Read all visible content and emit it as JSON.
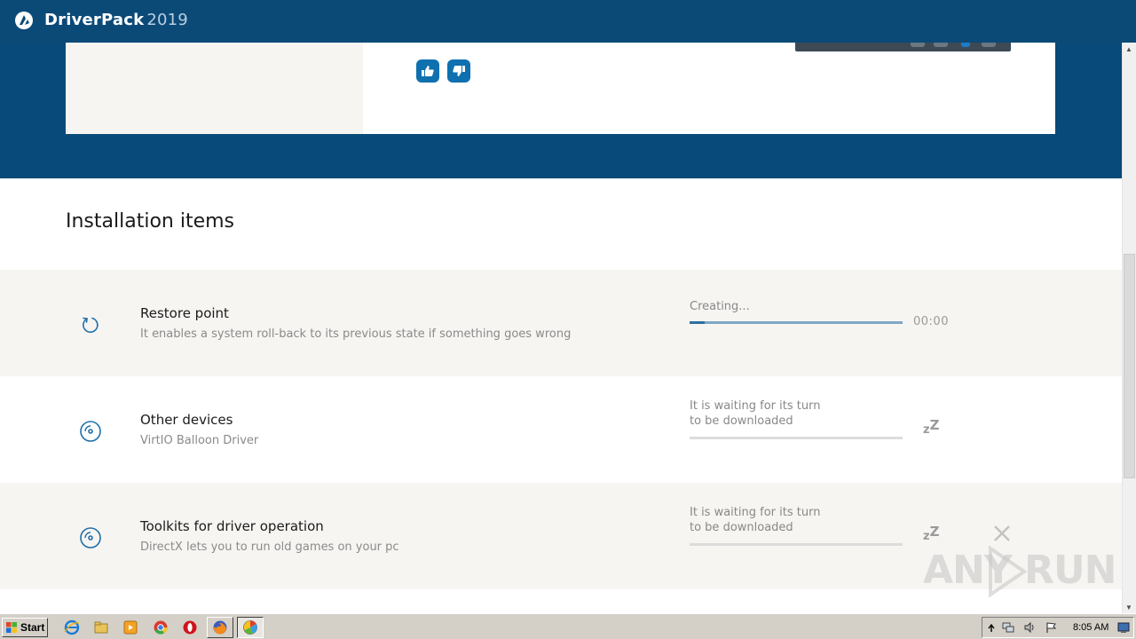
{
  "app": {
    "name": "DriverPack",
    "year": "2019"
  },
  "section": {
    "title": "Installation items"
  },
  "items": [
    {
      "title": "Restore point",
      "description": "It enables a system roll-back to its previous state if something goes wrong",
      "status": "Creating...",
      "time": "00:00",
      "progress": 0.07,
      "icon": "spinner-icon"
    },
    {
      "title": "Other devices",
      "description": "VirtIO Balloon Driver",
      "status_line1": "It is waiting for its turn",
      "status_line2": "to be downloaded",
      "sleep_small": "z",
      "sleep_big": "Z",
      "icon": "disc-icon"
    },
    {
      "title": "Toolkits for driver operation",
      "description": "DirectX lets you to run old games on your pc",
      "status_line1": "It is waiting for its turn",
      "status_line2": "to be downloaded",
      "sleep_small": "z",
      "sleep_big": "Z",
      "icon": "disc-icon"
    }
  ],
  "watermark": {
    "text": "ANY RUN"
  },
  "taskbar": {
    "start_label": "Start",
    "clock": "8:05 AM"
  },
  "colors": {
    "titlebar": "#0b4a77",
    "banner": "#084a79",
    "accent": "#0f70b0",
    "row_alt": "#f7f5f2"
  }
}
